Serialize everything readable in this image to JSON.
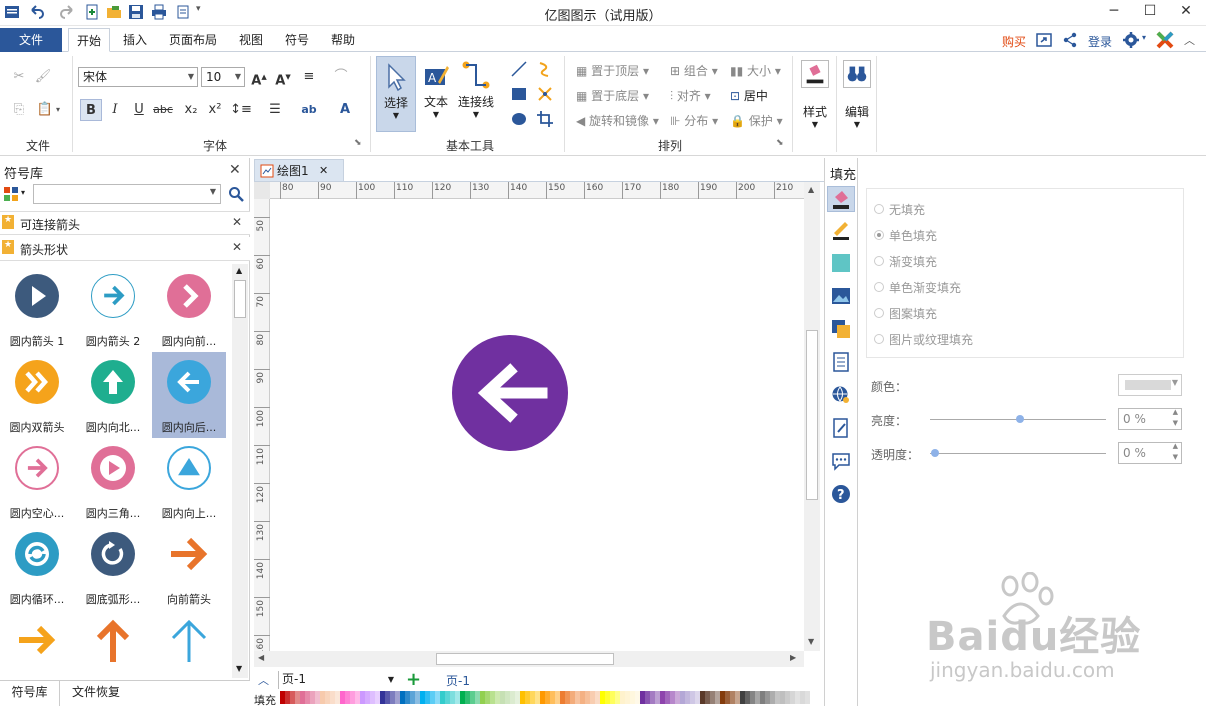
{
  "window": {
    "title": "亿图图示（试用版）"
  },
  "titlebar_right": {
    "buy": "购买",
    "login": "登录"
  },
  "ribbon_tabs": {
    "file": "文件",
    "home": "开始",
    "insert": "插入",
    "page_layout": "页面布局",
    "view": "视图",
    "symbol": "符号",
    "help": "帮助"
  },
  "ribbon": {
    "groups": {
      "file": "文件",
      "font": "字体",
      "basic_tools": "基本工具",
      "arrange": "排列"
    },
    "font": {
      "family": "宋体",
      "size": "10"
    },
    "tools": {
      "select": "选择",
      "text": "文本",
      "connector": "连接线"
    },
    "arrange": {
      "bring_front": "置于顶层",
      "send_back": "置于底层",
      "rotate_mirror": "旋转和镜像",
      "group": "组合",
      "align": "对齐",
      "distribute": "分布",
      "size": "大小",
      "center": "居中",
      "protect": "保护"
    },
    "style": "样式",
    "edit": "编辑"
  },
  "library": {
    "title": "符号库",
    "sections": [
      "可连接箭头",
      "箭头形状"
    ],
    "shapes": [
      {
        "label": "圆内箭头 1",
        "color": "#3d5a7d"
      },
      {
        "label": "圆内箭头 2",
        "color": "#2d9cc4"
      },
      {
        "label": "圆内向前...",
        "color": "#e06f97"
      },
      {
        "label": "圆内双箭头",
        "color": "#f5a31b"
      },
      {
        "label": "圆内向北...",
        "color": "#1fae8f"
      },
      {
        "label": "圆内向后...",
        "color": "#3ba6dc"
      },
      {
        "label": "圆内空心...",
        "color": "#e06f97"
      },
      {
        "label": "圆内三角...",
        "color": "#e06f97"
      },
      {
        "label": "圆内向上...",
        "color": "#3ba6dc"
      },
      {
        "label": "圆内循环...",
        "color": "#2d9cc4"
      },
      {
        "label": "圆底弧形...",
        "color": "#3d5a7d"
      },
      {
        "label": "向前箭头",
        "color": "#e8742b"
      }
    ],
    "bottom_tabs": [
      "符号库",
      "文件恢复"
    ]
  },
  "document": {
    "tab": "绘图1",
    "ruler_h": [
      "80",
      "90",
      "100",
      "110",
      "120",
      "130",
      "140",
      "150",
      "160",
      "170",
      "180",
      "190",
      "200",
      "210"
    ],
    "ruler_v": [
      "50",
      "60",
      "70",
      "80",
      "90",
      "100",
      "110",
      "120",
      "130",
      "140",
      "150",
      "160"
    ],
    "shape_color": "#7030a0"
  },
  "pages": {
    "selector": "页-1",
    "current": "页-1",
    "fill_label": "填充"
  },
  "fill_panel": {
    "title": "填充",
    "options": [
      "无填充",
      "单色填充",
      "渐变填充",
      "单色渐变填充",
      "图案填充",
      "图片或纹理填充"
    ],
    "color_label": "颜色：",
    "brightness_label": "亮度：",
    "brightness_value": "0 %",
    "transparency_label": "透明度：",
    "transparency_value": "0 %"
  },
  "watermark": {
    "logo": "Baidu经验",
    "url": "jingyan.baidu.com"
  }
}
